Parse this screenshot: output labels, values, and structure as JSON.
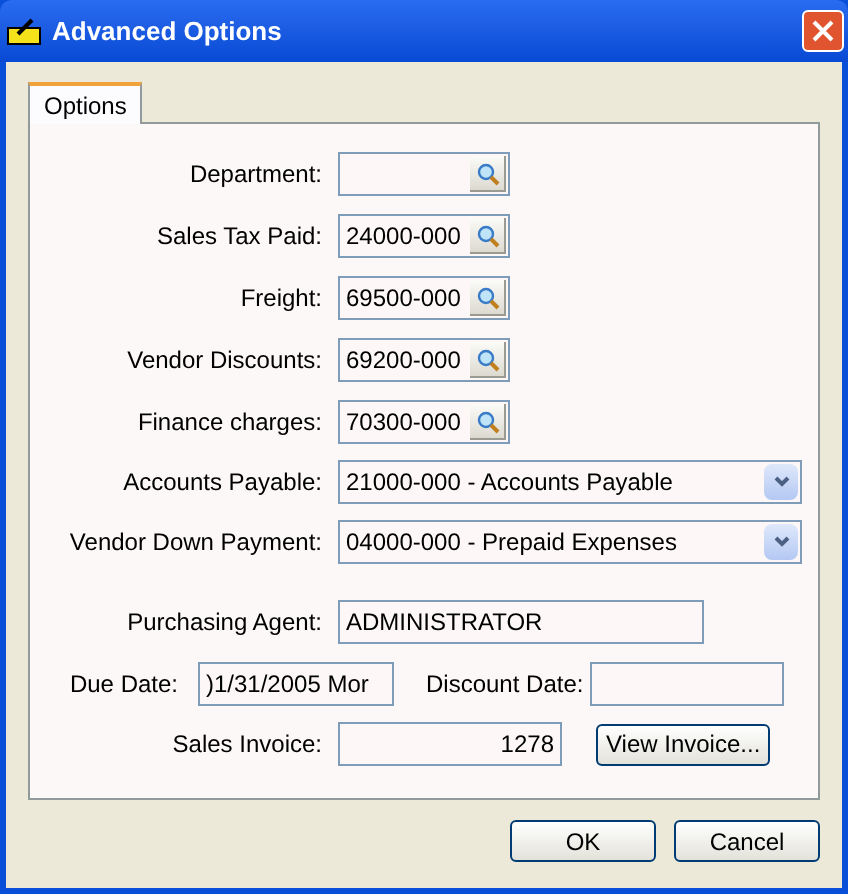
{
  "window": {
    "title": "Advanced Options"
  },
  "tabs": [
    {
      "label": "Options",
      "selected": true
    }
  ],
  "fields": [
    {
      "kind": "lookup",
      "label": "Department:"
    },
    {
      "kind": "lookup",
      "label": "Sales Tax Paid:",
      "value": "24000-000"
    },
    {
      "kind": "lookup",
      "label": "Freight:",
      "value": "69500-000"
    },
    {
      "kind": "lookup",
      "label": "Vendor Discounts:",
      "value": "69200-000"
    },
    {
      "kind": "lookup",
      "label": "Finance charges:",
      "value": "70300-000"
    },
    {
      "kind": "dropdown",
      "label": "Accounts Payable:",
      "value": "21000-000 - Accounts Payable"
    },
    {
      "kind": "dropdown",
      "label": "Vendor Down Payment:",
      "value": "04000-000 - Prepaid Expenses"
    },
    {
      "kind": "text",
      "label": "Purchasing Agent:",
      "value": "ADMINISTRATOR"
    }
  ],
  "due_date": {
    "label": "Due Date:",
    "value": ")1/31/2005 Mor"
  },
  "discount_date": {
    "label": "Discount Date:"
  },
  "sales_invoice": {
    "label": "Sales Invoice:",
    "value": "1278",
    "button": "View Invoice..."
  },
  "buttons": [
    "OK",
    "Cancel"
  ]
}
